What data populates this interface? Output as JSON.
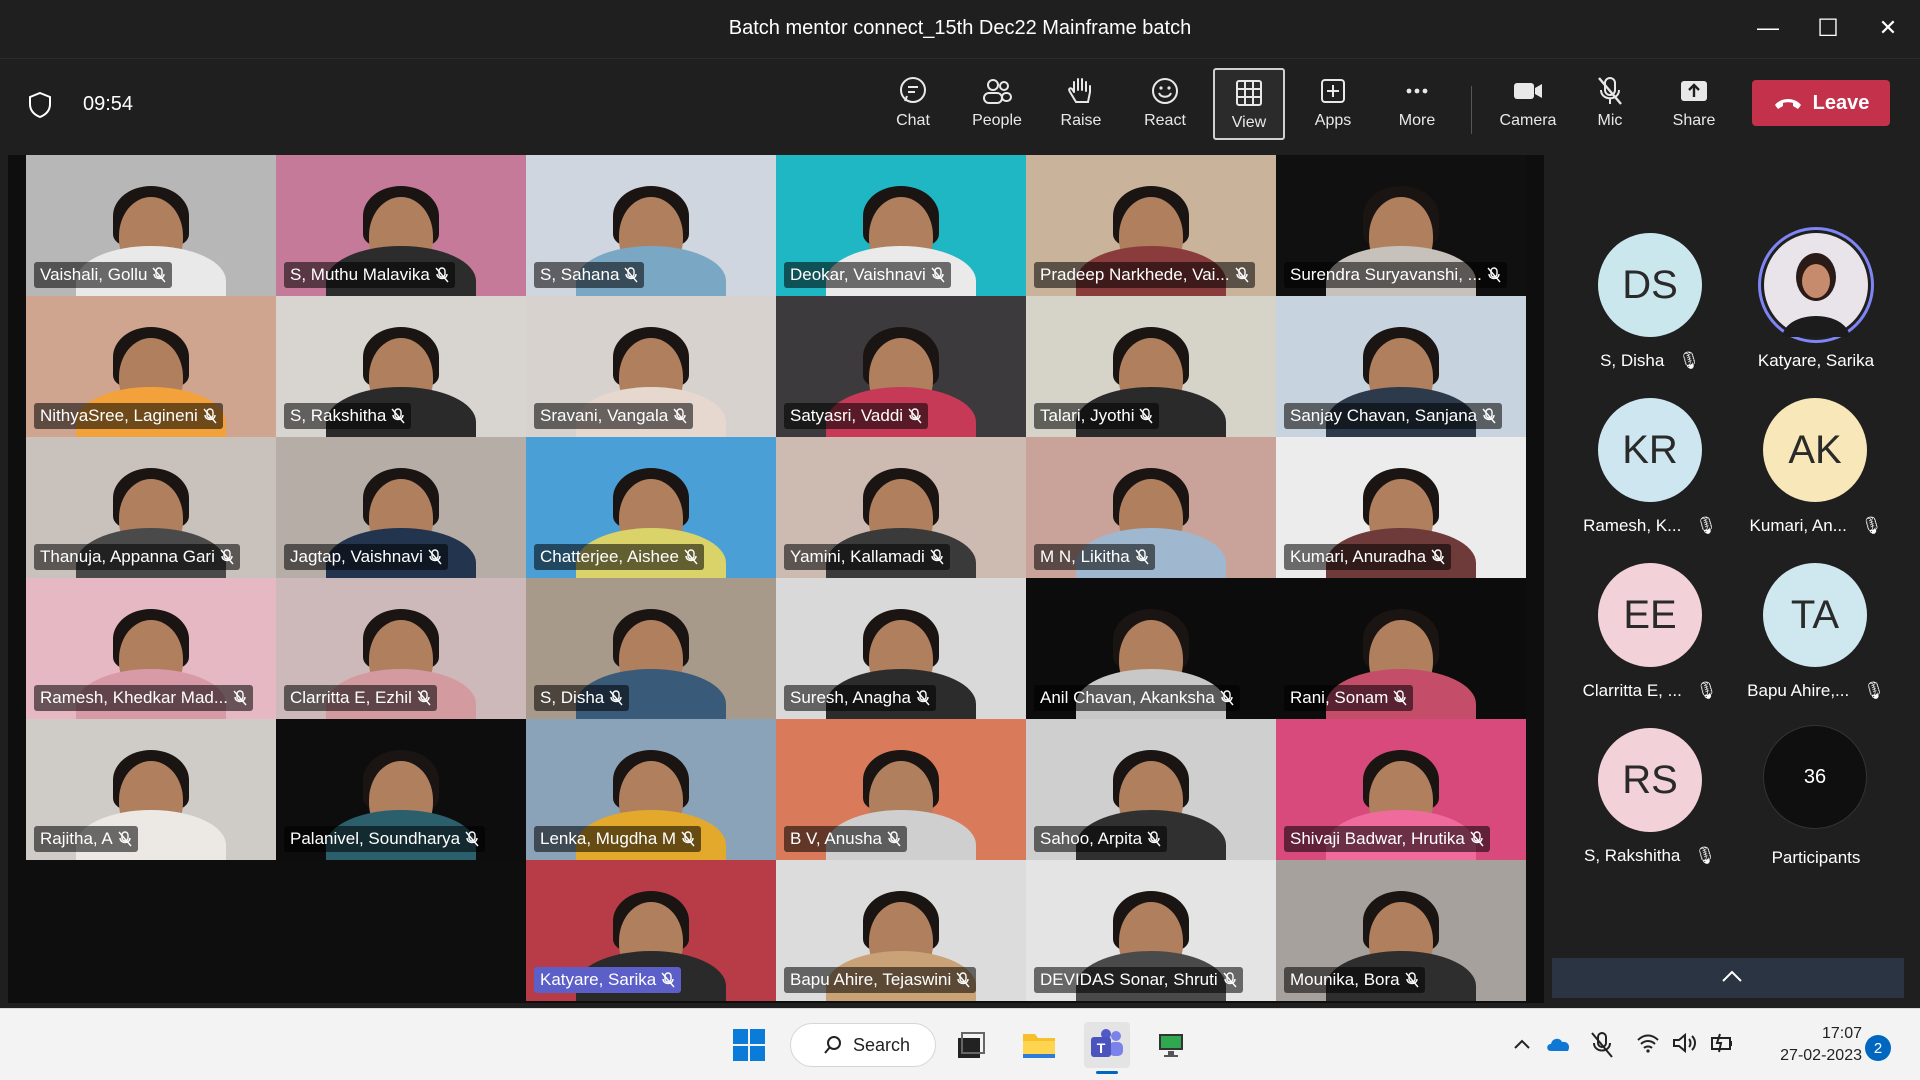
{
  "window": {
    "title": "Batch mentor connect_15th Dec22 Mainframe batch",
    "minimize": "—",
    "maximize": "☐",
    "close": "✕"
  },
  "toolbar": {
    "timer": "09:54",
    "buttons": [
      {
        "label": "Chat",
        "icon": "chat-icon"
      },
      {
        "label": "People",
        "icon": "people-icon"
      },
      {
        "label": "Raise",
        "icon": "hand-icon"
      },
      {
        "label": "React",
        "icon": "smile-icon"
      },
      {
        "label": "View",
        "icon": "grid-icon"
      },
      {
        "label": "Apps",
        "icon": "apps-icon"
      },
      {
        "label": "More",
        "icon": "more-icon"
      },
      {
        "label": "Camera",
        "icon": "camera-icon"
      },
      {
        "label": "Mic",
        "icon": "mic-off-icon"
      },
      {
        "label": "Share",
        "icon": "share-icon"
      }
    ],
    "leave": "Leave"
  },
  "tiles_left": [
    {
      "name": "Vaishali, Gollu",
      "bg": "#b7b7b7",
      "shirt": "#e9e9e9"
    },
    {
      "name": "S, Muthu Malavika",
      "bg": "#c57a9a",
      "shirt": "#2c2c2c"
    },
    {
      "name": "NithyaSree, Lagineni",
      "bg": "#cfa58f",
      "shirt": "#f3a23b"
    },
    {
      "name": "S, Rakshitha",
      "bg": "#d8d4d0",
      "shirt": "#2a2a2a"
    },
    {
      "name": "Thanuja, Appanna Gari",
      "bg": "#c9c1bb",
      "shirt": "#4a4a4a"
    },
    {
      "name": "Jagtap, Vaishnavi",
      "bg": "#b6aea6",
      "shirt": "#22344e"
    },
    {
      "name": "Ramesh, Khedkar Mad...",
      "bg": "#e6b8c4",
      "shirt": "#d99aa8"
    },
    {
      "name": "Clarritta E, Ezhil",
      "bg": "#cdb9b9",
      "shirt": "#d39aa0"
    },
    {
      "name": "Rajitha, A",
      "bg": "#cfcbc7",
      "shirt": "#ece8e4"
    },
    {
      "name": "Palanivel, Soundharya",
      "bg": "#0d0d0d",
      "shirt": "#2a5f6b"
    }
  ],
  "tiles_right": [
    {
      "name": "S, Sahana",
      "bg": "#d0d6e0",
      "shirt": "#7aa7c4",
      "hl": false
    },
    {
      "name": "Deokar, Vaishnavi",
      "bg": "#1fb7c4",
      "shirt": "#eaeaea",
      "hl": false
    },
    {
      "name": "Pradeep Narkhede, Vai...",
      "bg": "#c9b49b",
      "shirt": "#8a3b3b",
      "hl": false
    },
    {
      "name": "Surendra Suryavanshi, ...",
      "bg": "#101010",
      "shirt": "#c7c1bc",
      "hl": false
    },
    {
      "name": "Sravani, Vangala",
      "bg": "#d8d2cf",
      "shirt": "#e6d7cf",
      "hl": false
    },
    {
      "name": "Satyasri, Vaddi",
      "bg": "#3c3a3c",
      "shirt": "#c63a57",
      "hl": false
    },
    {
      "name": "Talari, Jyothi",
      "bg": "#d6d4c8",
      "shirt": "#2a2a2a",
      "hl": false
    },
    {
      "name": "Sanjay Chavan, Sanjana",
      "bg": "#c7d3de",
      "shirt": "#2d3a4b",
      "hl": false
    },
    {
      "name": "Chatterjee, Aishee",
      "bg": "#4aa0d6",
      "shirt": "#d9d36a",
      "hl": false
    },
    {
      "name": "Yamini, Kallamadi",
      "bg": "#cdbab1",
      "shirt": "#3a3a3a",
      "hl": false
    },
    {
      "name": "M N, Likitha",
      "bg": "#c9a39a",
      "shirt": "#9fb8cf",
      "hl": false
    },
    {
      "name": "Kumari, Anuradha",
      "bg": "#ececec",
      "shirt": "#6e3a3a",
      "hl": false
    },
    {
      "name": "S, Disha",
      "bg": "#a89a8a",
      "shirt": "#3a5a7a",
      "hl": false
    },
    {
      "name": "Suresh, Anagha",
      "bg": "#d9d9d9",
      "shirt": "#2c2c2c",
      "hl": false
    },
    {
      "name": "Anil Chavan, Akanksha",
      "bg": "#0c0c0c",
      "shirt": "#c8c8c8",
      "hl": false
    },
    {
      "name": "Rani, Sonam",
      "bg": "#0c0c0c",
      "shirt": "#c44d6a",
      "hl": false
    },
    {
      "name": "Lenka, Mugdha M",
      "bg": "#8aa3b8",
      "shirt": "#e2a92c",
      "hl": false
    },
    {
      "name": "B V, Anusha",
      "bg": "#d97a5a",
      "shirt": "#cfcfcf",
      "hl": false
    },
    {
      "name": "Sahoo, Arpita",
      "bg": "#cfcfcf",
      "shirt": "#303030",
      "hl": false
    },
    {
      "name": "Shivaji Badwar, Hrutika",
      "bg": "#d94a7c",
      "shirt": "#ef6b9b",
      "hl": false
    },
    {
      "name": "Katyare, Sarika",
      "bg": "#b83c48",
      "shirt": "#2a2a2a",
      "hl": true
    },
    {
      "name": "Bapu Ahire, Tejaswini",
      "bg": "#dcdcdc",
      "shirt": "#c9a278",
      "hl": false
    },
    {
      "name": "DEVIDAS Sonar, Shruti",
      "bg": "#e4e4e4",
      "shirt": "#4a4a4a",
      "hl": false
    },
    {
      "name": "Mounika, Bora",
      "bg": "#a6a19c",
      "shirt": "#2e2e2e",
      "hl": false
    }
  ],
  "side": {
    "avatars": [
      {
        "initials": "DS",
        "label": "S, Disha",
        "color": "#cbe7ee",
        "muted": true
      },
      {
        "initials": "",
        "label": "Katyare, Sarika",
        "color": "#4a3a48",
        "muted": false
      },
      {
        "initials": "KR",
        "label": "Ramesh, K...",
        "color": "#cde6f0",
        "muted": true
      },
      {
        "initials": "AK",
        "label": "Kumari, An...",
        "color": "#f8e7b8",
        "muted": true
      },
      {
        "initials": "EE",
        "label": "Clarritta E, ...",
        "color": "#f2d1d9",
        "muted": true
      },
      {
        "initials": "TA",
        "label": "Bapu Ahire,...",
        "color": "#cfe7ee",
        "muted": true
      },
      {
        "initials": "RS",
        "label": "S, Rakshitha",
        "color": "#f2d1d9",
        "muted": true
      }
    ],
    "participants_count": "36",
    "participants_label": "Participants"
  },
  "taskbar": {
    "search": "Search",
    "time": "17:07",
    "date": "27-02-2023",
    "notifications": "2"
  }
}
